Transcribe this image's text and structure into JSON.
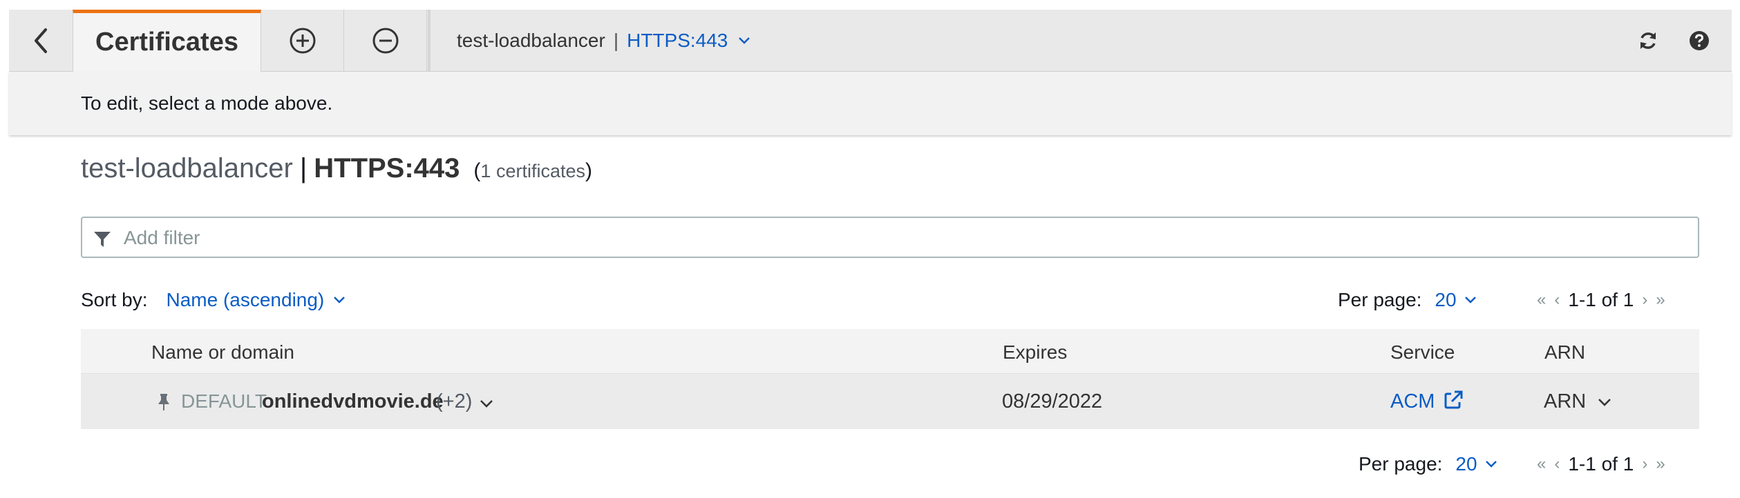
{
  "toolbar": {
    "tab_label": "Certificates",
    "loadbalancer": "test-loadbalancer",
    "separator": "|",
    "listener": "HTTPS:443"
  },
  "mode_hint": "To edit, select a mode above.",
  "heading": {
    "loadbalancer": "test-loadbalancer",
    "separator": "|",
    "listener": "HTTPS:443",
    "count_open": "(",
    "count_text": "1 certificates",
    "count_close": ")"
  },
  "filter": {
    "placeholder": "Add filter"
  },
  "sort": {
    "label": "Sort by:",
    "value": "Name (ascending)"
  },
  "pagination": {
    "per_page_label": "Per page:",
    "per_page_value": "20",
    "range": "1-1 of 1"
  },
  "table": {
    "headers": [
      "Name or domain",
      "Expires",
      "Service",
      "ARN"
    ],
    "rows": [
      {
        "default_tag": "DEFAULT",
        "domain": "onlinedvdmovie.de",
        "extra": "(+2)",
        "expires": "08/29/2022",
        "service": "ACM",
        "arn": "ARN"
      }
    ]
  },
  "colors": {
    "accent_tab": "#ec7211",
    "link": "#0a5cc4"
  }
}
